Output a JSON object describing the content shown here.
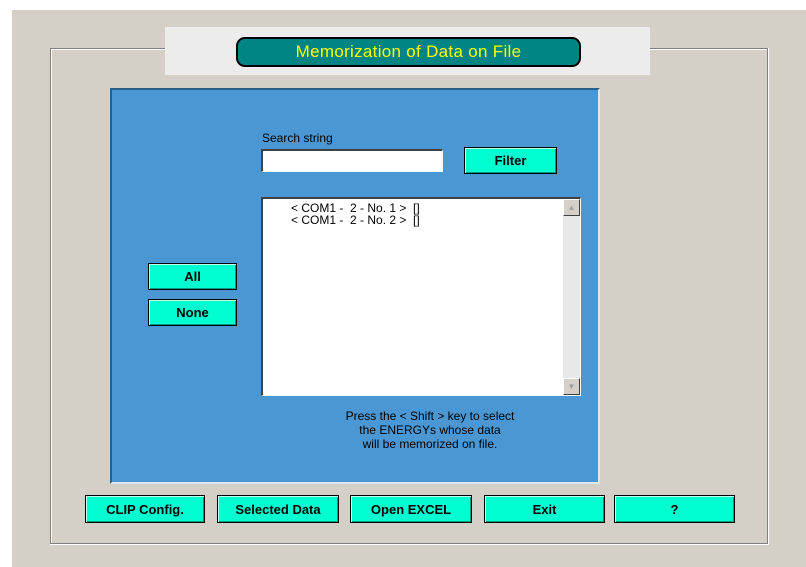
{
  "title": "Memorization of Data on File",
  "search": {
    "label": "Search string",
    "value": "",
    "placeholder": ""
  },
  "filter_label": "Filter",
  "selection_buttons": {
    "all": "All",
    "none": "None"
  },
  "list_items": [
    "< COM1 -  2 - No. 1 >  []",
    "< COM1 -  2 - No. 2 >  []"
  ],
  "hint_lines": [
    "Press the < Shift > key to select",
    "the ENERGYs whose data",
    "will be memorized on file."
  ],
  "bottom_buttons": {
    "clip_config": "CLIP Config.",
    "selected_data": "Selected Data",
    "open_excel": "Open EXCEL",
    "exit": "Exit",
    "help": "?"
  },
  "colors": {
    "title_background": "#008484",
    "title_text": "#ffff00",
    "panel_blue": "#4a97d3",
    "button_cyan": "#00ffd0",
    "window_gray": "#d4d0c8"
  },
  "icons": {
    "scroll_up": "scroll-up-arrow-icon",
    "scroll_down": "scroll-down-arrow-icon"
  }
}
